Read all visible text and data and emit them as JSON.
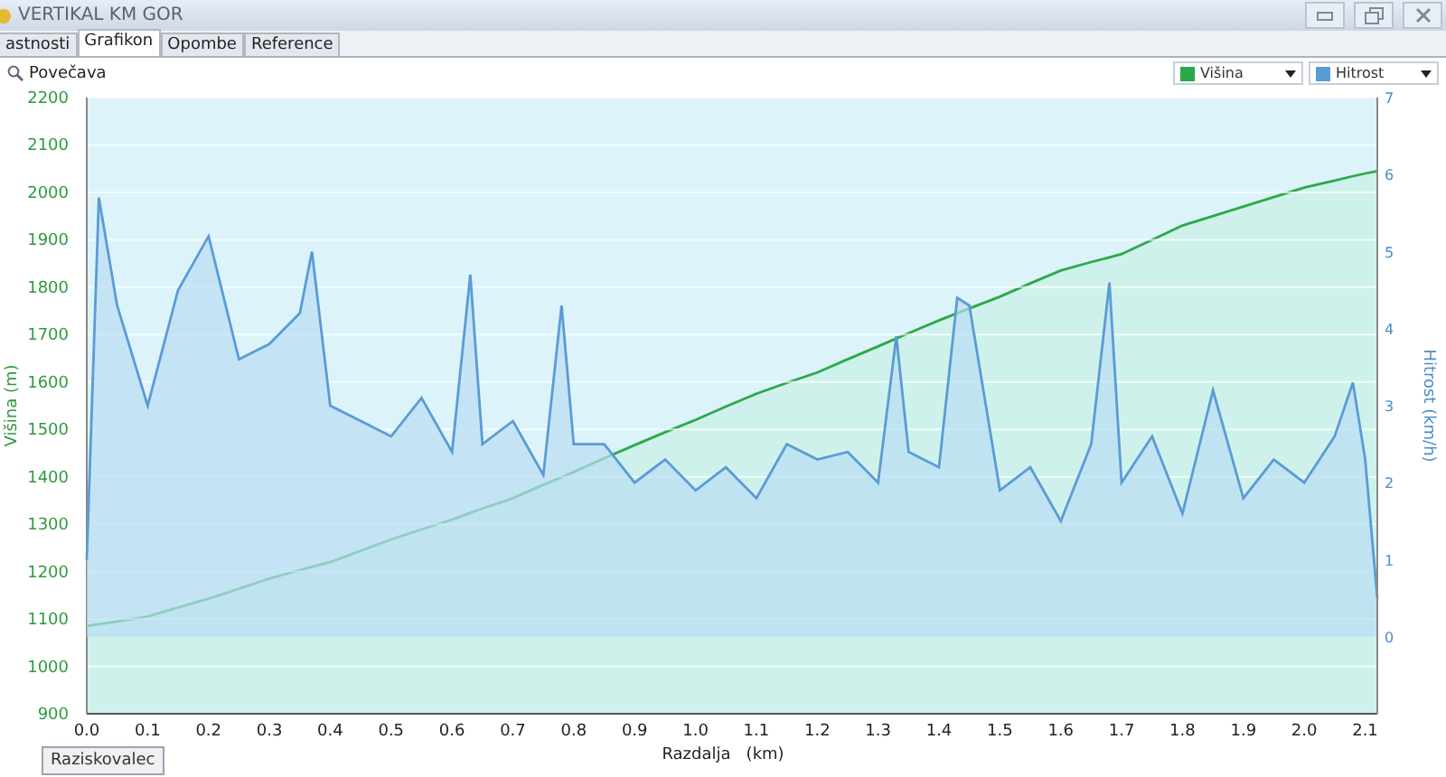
{
  "window": {
    "title": "VERTIKAL KM GOR"
  },
  "tabs": [
    {
      "label": "astnosti",
      "selected": false
    },
    {
      "label": "Grafikon",
      "selected": true
    },
    {
      "label": "Opombe",
      "selected": false
    },
    {
      "label": "Reference",
      "selected": false
    }
  ],
  "toolbar": {
    "zoom_label": "Povečava"
  },
  "elevation_chart": {
    "chart_data": {
      "type": "area",
      "xlabel": "Razdalja   (km)",
      "ylabel": "Višina (m)",
      "grid": true,
      "x": [
        0,
        0.02,
        0.05,
        0.1,
        0.15,
        0.2,
        0.25,
        0.3,
        0.35,
        0.37,
        0.4,
        0.45,
        0.5,
        0.55,
        0.6,
        0.63,
        0.65,
        0.7,
        0.75,
        0.78,
        0.8,
        0.85,
        0.9,
        0.95,
        1.0,
        1.05,
        1.1,
        1.15,
        1.2,
        1.25,
        1.3,
        1.33,
        1.35,
        1.4,
        1.43,
        1.45,
        1.5,
        1.55,
        1.6,
        1.65,
        1.68,
        1.7,
        1.75,
        1.8,
        1.85,
        1.9,
        1.95,
        2.0,
        2.05,
        2.08,
        2.1,
        2.12
      ],
      "series": [
        {
          "name": "Višina",
          "color": "#2ca84a",
          "values": [
            1085,
            1089,
            1095,
            1105,
            1124,
            1143,
            1164,
            1185,
            1203,
            1210,
            1220,
            1244,
            1268,
            1289,
            1310,
            1324,
            1333,
            1355,
            1383,
            1399,
            1410,
            1439,
            1467,
            1494,
            1520,
            1548,
            1575,
            1598,
            1620,
            1648,
            1675,
            1692,
            1703,
            1730,
            1745,
            1755,
            1780,
            1808,
            1835,
            1853,
            1863,
            1870,
            1900,
            1930,
            1950,
            1970,
            1990,
            2010,
            2025,
            2034,
            2040,
            2045
          ]
        }
      ],
      "xlim": [
        0,
        2.12
      ],
      "ylim": [
        900,
        2200
      ],
      "xticks": [
        {
          "value": 0,
          "label": "0.0"
        },
        0.1,
        0.2,
        0.3,
        0.4,
        0.5,
        0.6,
        0.7,
        0.8,
        0.9,
        {
          "value": 1,
          "label": "1.0"
        },
        1.1,
        1.2,
        1.3,
        1.4,
        1.5,
        1.6,
        1.7,
        1.8,
        1.9,
        {
          "value": 2,
          "label": "2.0"
        },
        2.1
      ],
      "yticks": [
        900,
        1000,
        1100,
        1200,
        1300,
        1400,
        1500,
        1600,
        1700,
        1800,
        1900,
        2000,
        2100,
        2200
      ]
    }
  },
  "speed_chart": {
    "chart_data": {
      "type": "area",
      "ylabel": "Hitrost (km/h)",
      "x": [
        0,
        0.02,
        0.05,
        0.1,
        0.15,
        0.2,
        0.25,
        0.3,
        0.35,
        0.37,
        0.4,
        0.45,
        0.5,
        0.55,
        0.6,
        0.63,
        0.65,
        0.7,
        0.75,
        0.78,
        0.8,
        0.85,
        0.9,
        0.95,
        1.0,
        1.05,
        1.1,
        1.15,
        1.2,
        1.25,
        1.3,
        1.33,
        1.35,
        1.4,
        1.43,
        1.45,
        1.5,
        1.55,
        1.6,
        1.65,
        1.68,
        1.7,
        1.75,
        1.8,
        1.85,
        1.9,
        1.95,
        2.0,
        2.05,
        2.08,
        2.1,
        2.12
      ],
      "series": [
        {
          "name": "Hitrost",
          "color": "#5b9bd5",
          "values": [
            1,
            5.7,
            4.3,
            3,
            4.5,
            5.2,
            3.6,
            3.8,
            4.2,
            5,
            3,
            2.8,
            2.6,
            3.1,
            2.4,
            4.7,
            2.5,
            2.8,
            2.1,
            4.3,
            2.5,
            2.5,
            2,
            2.3,
            1.9,
            2.2,
            1.8,
            2.5,
            2.3,
            2.4,
            2,
            3.9,
            2.4,
            2.2,
            4.4,
            4.3,
            1.9,
            2.2,
            1.5,
            2.5,
            4.6,
            2,
            2.6,
            1.6,
            3.2,
            1.8,
            2.3,
            2,
            2.6,
            3.3,
            2.3,
            0.5
          ]
        }
      ],
      "xlim": [
        0,
        2.12
      ],
      "ylim": [
        -1,
        7
      ],
      "yticks": [
        0,
        1,
        2,
        3,
        4,
        5,
        6,
        7
      ]
    }
  },
  "bottom_button": "Raziskovalec"
}
